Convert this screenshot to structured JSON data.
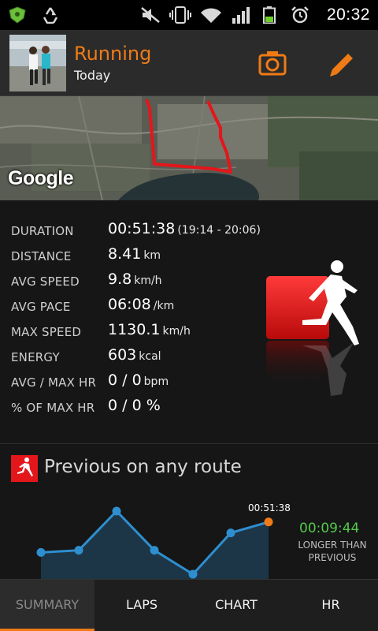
{
  "status_bar": {
    "time": "20:32",
    "icons": [
      "shield-icon",
      "recycle-icon",
      "mute-icon",
      "vibrate-icon",
      "wifi-icon",
      "signal-icon",
      "battery-icon",
      "alarm-icon"
    ]
  },
  "header": {
    "title": "Running",
    "subtitle": "Today",
    "camera_icon": "camera-icon",
    "edit_icon": "pencil-icon",
    "accent": "#f07b16"
  },
  "map": {
    "logo": "Google",
    "route_color": "#e3161b"
  },
  "stats": [
    {
      "label": "DURATION",
      "value": "00:51:38",
      "extra": "(19:14 - 20:06)",
      "unit": ""
    },
    {
      "label": "DISTANCE",
      "value": "8.41",
      "unit": "km"
    },
    {
      "label": "AVG SPEED",
      "value": "9.8",
      "unit": "km/h"
    },
    {
      "label": "AVG PACE",
      "value": "06:08",
      "unit": "/km"
    },
    {
      "label": "MAX SPEED",
      "value": "1130.1",
      "unit": "km/h"
    },
    {
      "label": "ENERGY",
      "value": "603",
      "unit": "kcal"
    },
    {
      "label": "AVG / MAX HR",
      "value": "0 / 0",
      "unit": "bpm"
    },
    {
      "label": "% OF MAX HR",
      "value": "0 / 0 %",
      "unit": ""
    }
  ],
  "previous": {
    "title": "Previous on any route",
    "current_label": "00:51:38",
    "diff_value": "00:09:44",
    "diff_label": "LONGER THAN PREVIOUS",
    "diff_color": "#54c94a"
  },
  "chart_data": {
    "type": "line",
    "series": [
      {
        "values": [
          57,
          58,
          76,
          58,
          47,
          66,
          71
        ]
      }
    ],
    "ylim": [
      47,
      76
    ],
    "highlight_last": true,
    "annotation": "00:51:38",
    "line_color": "#2e8fd0",
    "point_color": "#2e8fd0",
    "last_point_color": "#f07b16"
  },
  "tabs": [
    {
      "label": "SUMMARY",
      "active": true
    },
    {
      "label": "LAPS",
      "active": false
    },
    {
      "label": "CHART",
      "active": false
    },
    {
      "label": "HR",
      "active": false
    }
  ]
}
